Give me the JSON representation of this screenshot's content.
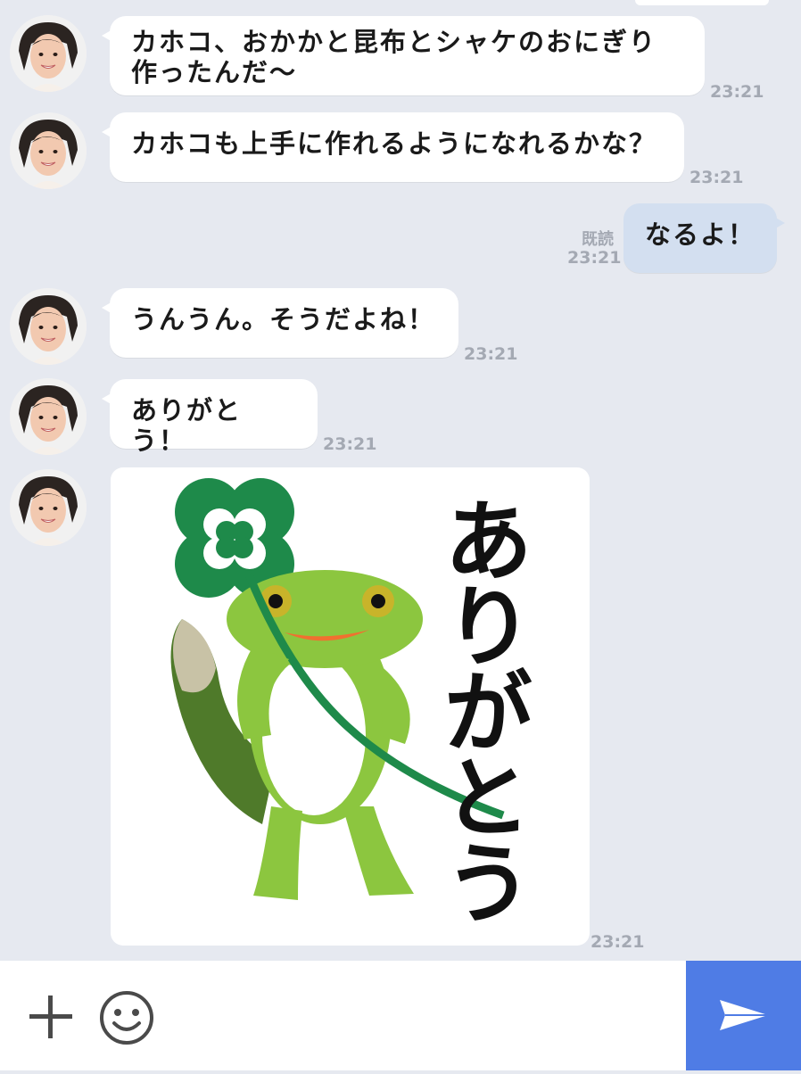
{
  "messages": [
    {
      "text": "カホコ、おかかと昆布とシャケのおにぎり\n作ったんだ〜",
      "time": "23:21"
    },
    {
      "text": "カホコも上手に作れるようになれるかな？",
      "time": "23:21"
    },
    {
      "text": "なるよ！",
      "time": "23:21",
      "read": "既読"
    },
    {
      "text": "うんうん。そうだよね！",
      "time": "23:21"
    },
    {
      "text": "ありがとう！",
      "time": "23:21"
    },
    {
      "sticker_text": "ありがとう",
      "time": "23:21"
    }
  ],
  "input_bar": {
    "add_icon": "plus-icon",
    "emoji_icon": "smiley-icon",
    "send_icon": "paper-plane-icon"
  },
  "colors": {
    "background": "#e6e9f0",
    "bubble_in": "#ffffff",
    "bubble_out": "#d3dff0",
    "timestamp": "#a4a9b3",
    "send_button": "#4f7ce5"
  }
}
